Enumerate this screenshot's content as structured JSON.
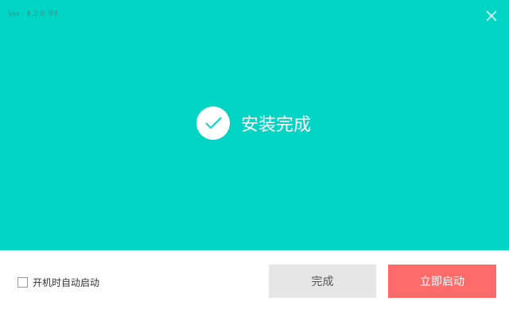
{
  "header": {
    "version": "Ver: 4.2.0.99"
  },
  "status": {
    "icon": "check-icon",
    "text": "安装完成"
  },
  "footer": {
    "autostart_label": "开机时自动启动",
    "autostart_checked": false,
    "finish_label": "完成",
    "launch_label": "立即启动"
  },
  "colors": {
    "hero_bg": "#03d5c5",
    "launch_button": "#ff6b6b",
    "finish_button": "#e6e6e6"
  }
}
